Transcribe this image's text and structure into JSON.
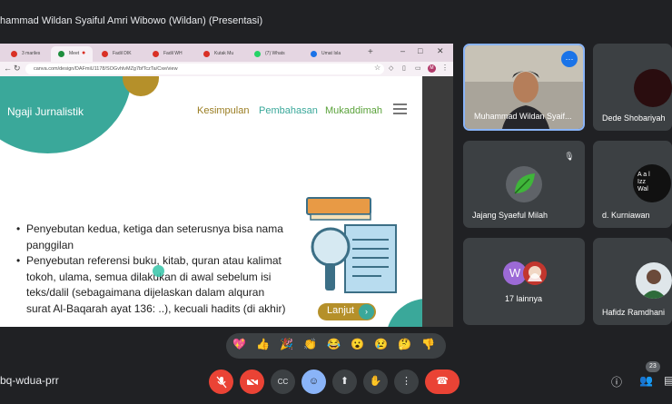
{
  "header": {
    "presenter_title": "hammad Wildan Syaiful Amri Wibowo (Wildan) (Presentasi)"
  },
  "browser": {
    "tabs": [
      {
        "label": "3 mariles",
        "icon": "gmail-icon",
        "color": "#d93025",
        "active": false
      },
      {
        "label": "Meet",
        "icon": "meet-icon",
        "color": "#1e8e3e",
        "active": true
      },
      {
        "label": "Fadil DIK",
        "icon": "doc-icon",
        "color": "#d93025",
        "active": false
      },
      {
        "label": "Fadil WH",
        "icon": "doc-icon",
        "color": "#d93025",
        "active": false
      },
      {
        "label": "Kutak Mu",
        "icon": "doc-icon",
        "color": "#d93025",
        "active": false
      },
      {
        "label": "(7) Whats",
        "icon": "whatsapp-icon",
        "color": "#25d366",
        "active": false
      },
      {
        "label": "Umat Isla",
        "icon": "doc-icon",
        "color": "#1a73e8",
        "active": false
      }
    ],
    "new_tab": "+",
    "url": "canva.com/design/DAFmiU1178/SOGvhlvMZg7bfTczTa/Cxe/view",
    "profile_initial": "M"
  },
  "slide": {
    "brand": "Ngaji Jurnalistik",
    "nav": [
      "Kesimpulan",
      "Pembahasan",
      "Mukaddimah"
    ],
    "bullets": [
      "Penyebutan kedua, ketiga dan seterusnya bisa nama panggilan",
      "Penyebutan referensi buku, kitab, quran atau kalimat tokoh, ulama, semua dilakukan di awal sebelum isi teks/dalil (sebagaimana dijelaskan dalam alquran surat Al-Baqarah ayat 136: ..), kecuali hadits (di akhir)"
    ],
    "next_button": "Lanjut",
    "colors": {
      "teal": "#3aa89a",
      "gold": "#b5902a",
      "green_text": "#5aa23a"
    }
  },
  "participants": [
    {
      "name": "Muhammad Wildan Syaif...",
      "speaking": true
    },
    {
      "name": "Dede Shobariyah",
      "speaking": false
    },
    {
      "name": "Jajang Syaeful Milah",
      "muted": true
    },
    {
      "name": "d. Kurniawan",
      "avatar_text": "A a l\nIzz\nWal"
    },
    {
      "name": "17 lainnya",
      "avatar_initial": "W"
    },
    {
      "name": "Hafidz Ramdhani"
    }
  ],
  "reactions": [
    "💖",
    "👍",
    "🎉",
    "👏",
    "😂",
    "😮",
    "😢",
    "🤔",
    "👎"
  ],
  "footer": {
    "meeting_code": "bq-wdua-prr",
    "participant_count": "23"
  }
}
